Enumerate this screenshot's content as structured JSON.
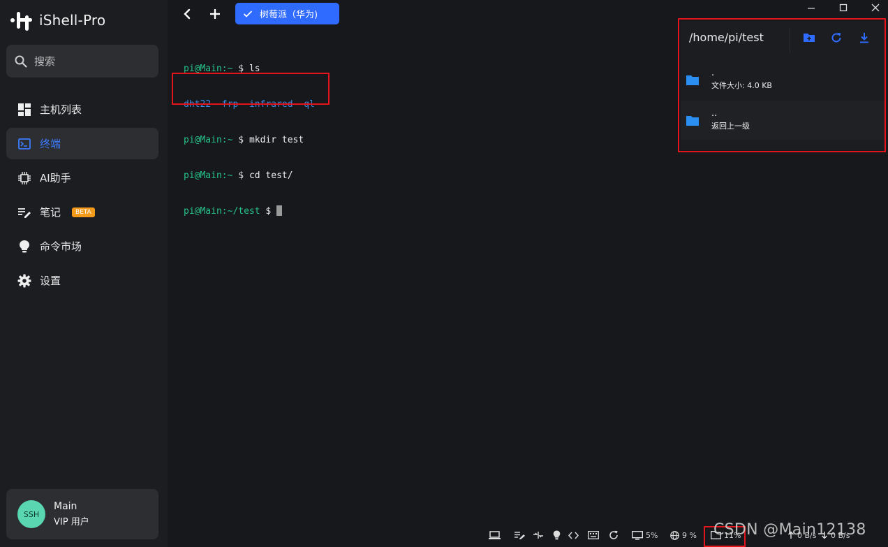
{
  "app": {
    "name": "iShell-Pro"
  },
  "search": {
    "placeholder": "搜索"
  },
  "nav": {
    "items": [
      {
        "label": "主机列表",
        "icon": "dashboard-icon",
        "active": false
      },
      {
        "label": "终端",
        "icon": "terminal-icon",
        "active": true
      },
      {
        "label": "AI助手",
        "icon": "ai-chip-icon",
        "active": false
      },
      {
        "label": "笔记",
        "icon": "note-edit-icon",
        "active": false,
        "badge": "BETA"
      },
      {
        "label": "命令市场",
        "icon": "lightbulb-icon",
        "active": false
      },
      {
        "label": "设置",
        "icon": "gear-icon",
        "active": false
      }
    ]
  },
  "user": {
    "avatar_text": "SSH",
    "name": "Main",
    "level": "VIP 用户"
  },
  "tabs": [
    {
      "label": "树莓派（华为)",
      "selected": true
    }
  ],
  "terminal": {
    "lines": [
      {
        "prompt": "pi@Main",
        "path": ":~",
        "dollar": " $ ",
        "cmd": "ls"
      },
      {
        "output": [
          "dht22",
          "frp",
          "infrared",
          "ql"
        ]
      },
      {
        "prompt": "pi@Main",
        "path": ":~",
        "dollar": " $ ",
        "cmd": "mkdir test"
      },
      {
        "prompt": "pi@Main",
        "path": ":~",
        "dollar": " $ ",
        "cmd": "cd test/"
      },
      {
        "prompt": "pi@Main",
        "path": ":~/test",
        "dollar": " $ ",
        "cmd": ""
      }
    ]
  },
  "files": {
    "path": "/home/pi/test",
    "items": [
      {
        "name": ".",
        "detail": "文件大小: 4.0 KB"
      },
      {
        "name": "..",
        "detail": "返回上一级"
      }
    ]
  },
  "statusbar": {
    "cpu": "5%",
    "network": "9 %",
    "disk": "11%",
    "upload": "0 B/s",
    "download": "0 B/s"
  },
  "watermark": "CSDN @Main12138",
  "colors": {
    "accent": "#2f6bff",
    "prompt": "#27c28a",
    "highlight_box": "#e3141b",
    "folder": "#2b8ff2"
  }
}
